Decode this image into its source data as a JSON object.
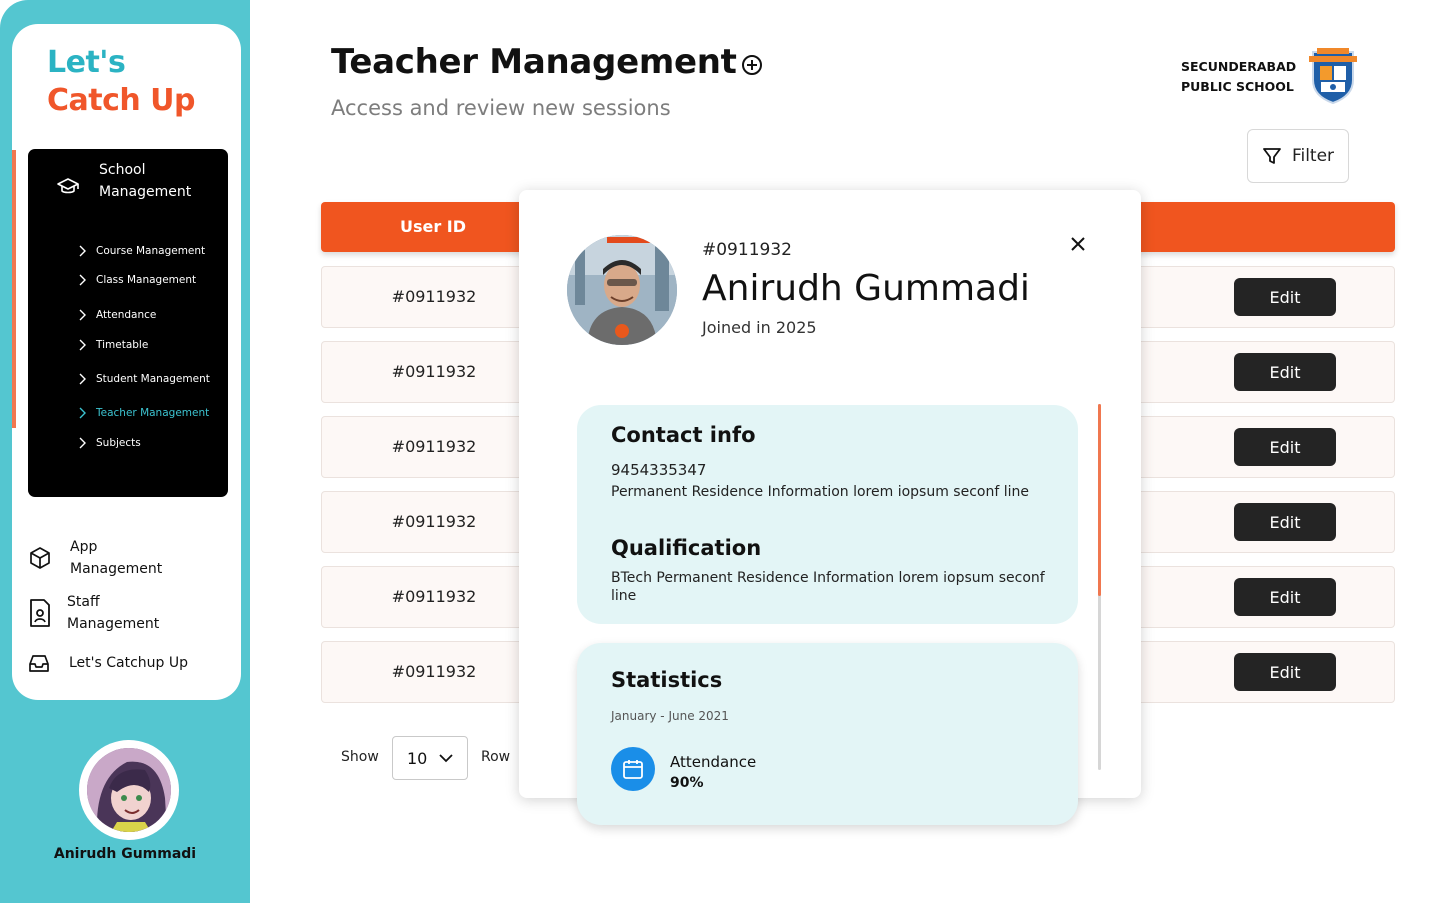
{
  "sidebar": {
    "logo_line1": "Let's",
    "logo_line2": "Catch Up",
    "school_menu": {
      "label": "School Management",
      "items": [
        {
          "label": "Course Management"
        },
        {
          "label": "Class Management"
        },
        {
          "label": "Attendance"
        },
        {
          "label": "Timetable"
        },
        {
          "label": "Student Management"
        },
        {
          "label": "Teacher Management"
        },
        {
          "label": "Subjects"
        }
      ],
      "active_item": "Teacher Management"
    },
    "app_management": "App Management",
    "staff_management": "Staff Management",
    "catchup": "Let's Catchup Up",
    "user_name": "Anirudh Gummadi"
  },
  "header": {
    "title": "Teacher Management",
    "subtitle": "Access and review new sessions",
    "school_line1": "SECUNDERABAD",
    "school_line2": "PUBLIC SCHOOL",
    "filter_label": "Filter"
  },
  "table": {
    "col_user_id": "User ID",
    "rows": [
      {
        "user_id": "#0911932",
        "action": "Edit"
      },
      {
        "user_id": "#0911932",
        "action": "Edit"
      },
      {
        "user_id": "#0911932",
        "action": "Edit"
      },
      {
        "user_id": "#0911932",
        "action": "Edit"
      },
      {
        "user_id": "#0911932",
        "action": "Edit"
      },
      {
        "user_id": "#0911932",
        "action": "Edit"
      }
    ]
  },
  "pagination": {
    "show_label": "Show",
    "rows_value": "10",
    "row_label": "Row"
  },
  "modal": {
    "user_id": "#0911932",
    "name": "Anirudh Gummadi",
    "joined": "Joined in 2025",
    "contact_heading": "Contact info",
    "phone": "9454335347",
    "address": "Permanent Residence Information lorem iopsum seconf line",
    "qualification_heading": "Qualification",
    "qualification": "BTech Permanent Residence Information lorem iopsum seconf line",
    "statistics_heading": "Statistics",
    "period": "January - June 2021",
    "attendance_label": "Attendance",
    "attendance_value": "90%"
  },
  "colors": {
    "accent_orange": "#f0551f",
    "accent_teal": "#54c6d0",
    "card_bg": "#e3f5f6",
    "edit_button": "#242424"
  }
}
